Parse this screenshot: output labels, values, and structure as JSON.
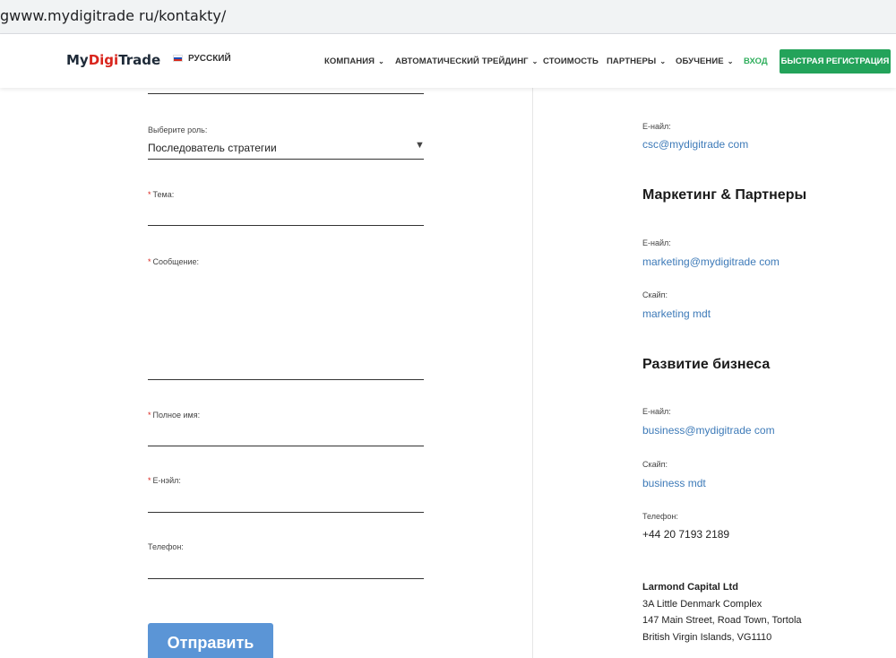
{
  "browser": {
    "url": "gwww.mydigitrade ru/kontakty/"
  },
  "header": {
    "logo": {
      "part1": "My",
      "part2": "Digi",
      "part3": "Trade"
    },
    "language": "РУССКИЙ",
    "nav": [
      {
        "label": "КОМПАНИЯ",
        "has_dropdown": true
      },
      {
        "label": "АВТОМАТИЧЕСКИЙ ТРЕЙДИНГ",
        "has_dropdown": true
      },
      {
        "label": "СТОИМОСТЬ",
        "has_dropdown": false
      },
      {
        "label": "ПАРТНЕРЫ",
        "has_dropdown": true
      },
      {
        "label": "ОБУЧЕНИЕ",
        "has_dropdown": true
      }
    ],
    "chevron": "⌄",
    "login": "ВХОД",
    "register": "БЫСТРАЯ РЕГИСТРАЦИЯ"
  },
  "form": {
    "role_label": "Выберите роль:",
    "role_value": "Последователь стратегии",
    "subject_label": "Тема:",
    "message_label": "Сообщение:",
    "fullname_label": "Полное имя:",
    "email_label": "Е-нэйл:",
    "phone_label": "Телефон:",
    "required_mark": "*",
    "submit": "Отправить",
    "caret": "▼"
  },
  "contacts": {
    "support": {
      "email_label": "Е-найл:",
      "email": "csc@mydigitrade com"
    },
    "marketing": {
      "title": "Маркетинг & Партнеры",
      "email_label": "Е-найл:",
      "email": "marketing@mydigitrade com",
      "skype_label": "Скайп:",
      "skype": "marketing mdt"
    },
    "business": {
      "title": "Развитие бизнеса",
      "email_label": "Е-найл:",
      "email": "business@mydigitrade com",
      "skype_label": "Скайп:",
      "skype": "business mdt",
      "phone_label": "Телефон:",
      "phone": "+44 20 7193 2189"
    },
    "address": {
      "company": "Larmond Capital Ltd",
      "line1": "3A Little Denmark Complex",
      "line2": "147 Main Street, Road Town, Tortola",
      "line3": "British Virgin Islands, VG1110"
    }
  },
  "colors": {
    "logo_accent": "#d9251d",
    "register_bg": "#23a35a",
    "login_text": "#2fae5c",
    "link": "#3d7ab8",
    "submit_bg": "#5b95d6"
  }
}
